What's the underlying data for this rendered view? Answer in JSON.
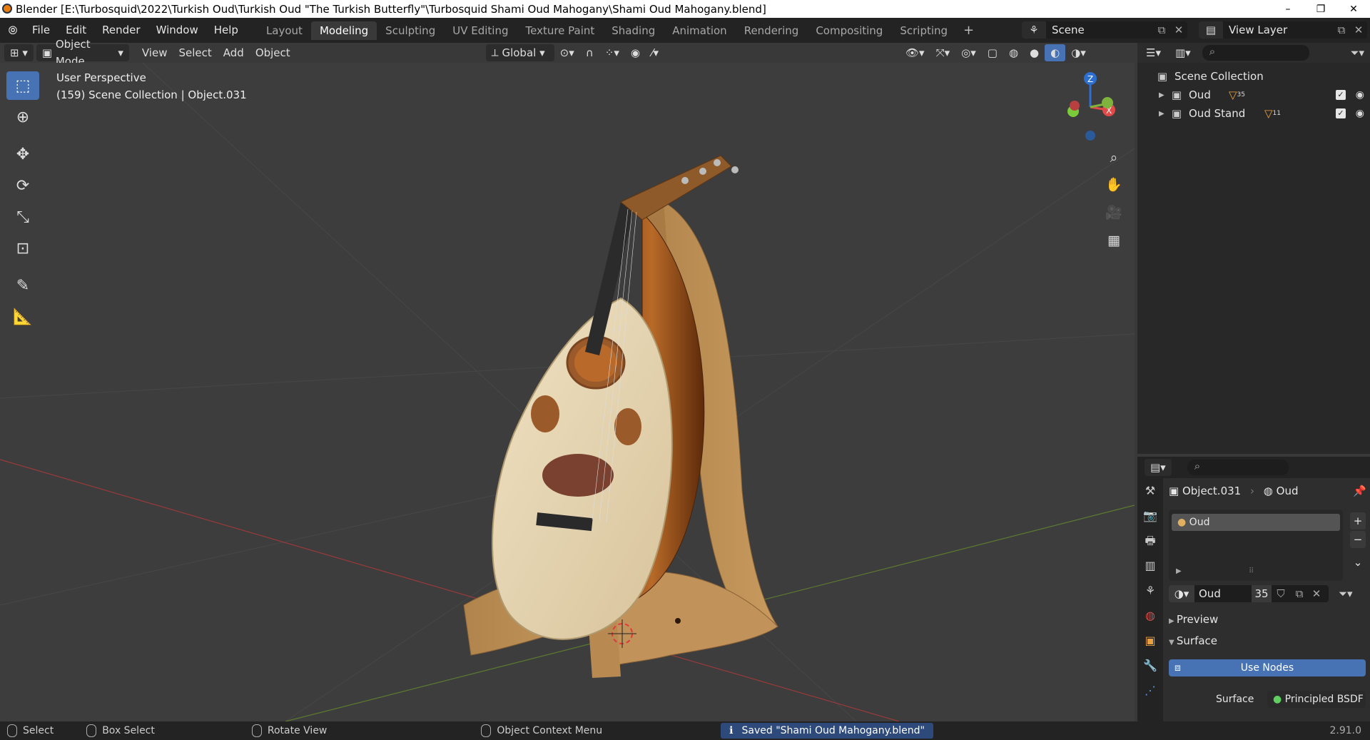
{
  "titlebar": {
    "title": "Blender [E:\\Turbosquid\\2022\\Turkish Oud\\Turkish Oud \"The Turkish Butterfly\"\\Turbosquid Shami Oud Mahogany\\Shami Oud Mahogany.blend]",
    "minimize": "–",
    "restore": "❐",
    "close": "✕"
  },
  "menu": [
    "File",
    "Edit",
    "Render",
    "Window",
    "Help"
  ],
  "workspaces": [
    "Layout",
    "Modeling",
    "Sculpting",
    "UV Editing",
    "Texture Paint",
    "Shading",
    "Animation",
    "Rendering",
    "Compositing",
    "Scripting"
  ],
  "active_workspace": "Modeling",
  "scene": {
    "name": "Scene"
  },
  "view_layer": {
    "name": "View Layer"
  },
  "viewport_header": {
    "mode": "Object Mode",
    "menus": [
      "View",
      "Select",
      "Add",
      "Object"
    ],
    "orientation": "Global"
  },
  "viewport": {
    "perspective": "User Perspective",
    "info": "(159) Scene Collection | Object.031",
    "gizmo": {
      "z": "Z",
      "x": "X"
    }
  },
  "outliner": {
    "root": "Scene Collection",
    "items": [
      {
        "name": "Oud",
        "badge": "35"
      },
      {
        "name": "Oud Stand",
        "badge": "11"
      }
    ]
  },
  "properties": {
    "object": "Object.031",
    "material_context": "Oud",
    "slot": "Oud",
    "material_name": "Oud",
    "users": "35",
    "preview_label": "Preview",
    "surface_label": "Surface",
    "use_nodes": "Use Nodes",
    "surface_field_label": "Surface",
    "surface_shader": "Principled BSDF"
  },
  "statusbar": {
    "select": "Select",
    "box_select": "Box Select",
    "rotate": "Rotate View",
    "context": "Object Context Menu",
    "message": "Saved \"Shami Oud Mahogany.blend\"",
    "version": "2.91.0"
  },
  "colors": {
    "accent": "#4772b3",
    "x_axis": "#e24a4a",
    "y_axis": "#80b33e",
    "z_axis": "#2d6fce"
  }
}
